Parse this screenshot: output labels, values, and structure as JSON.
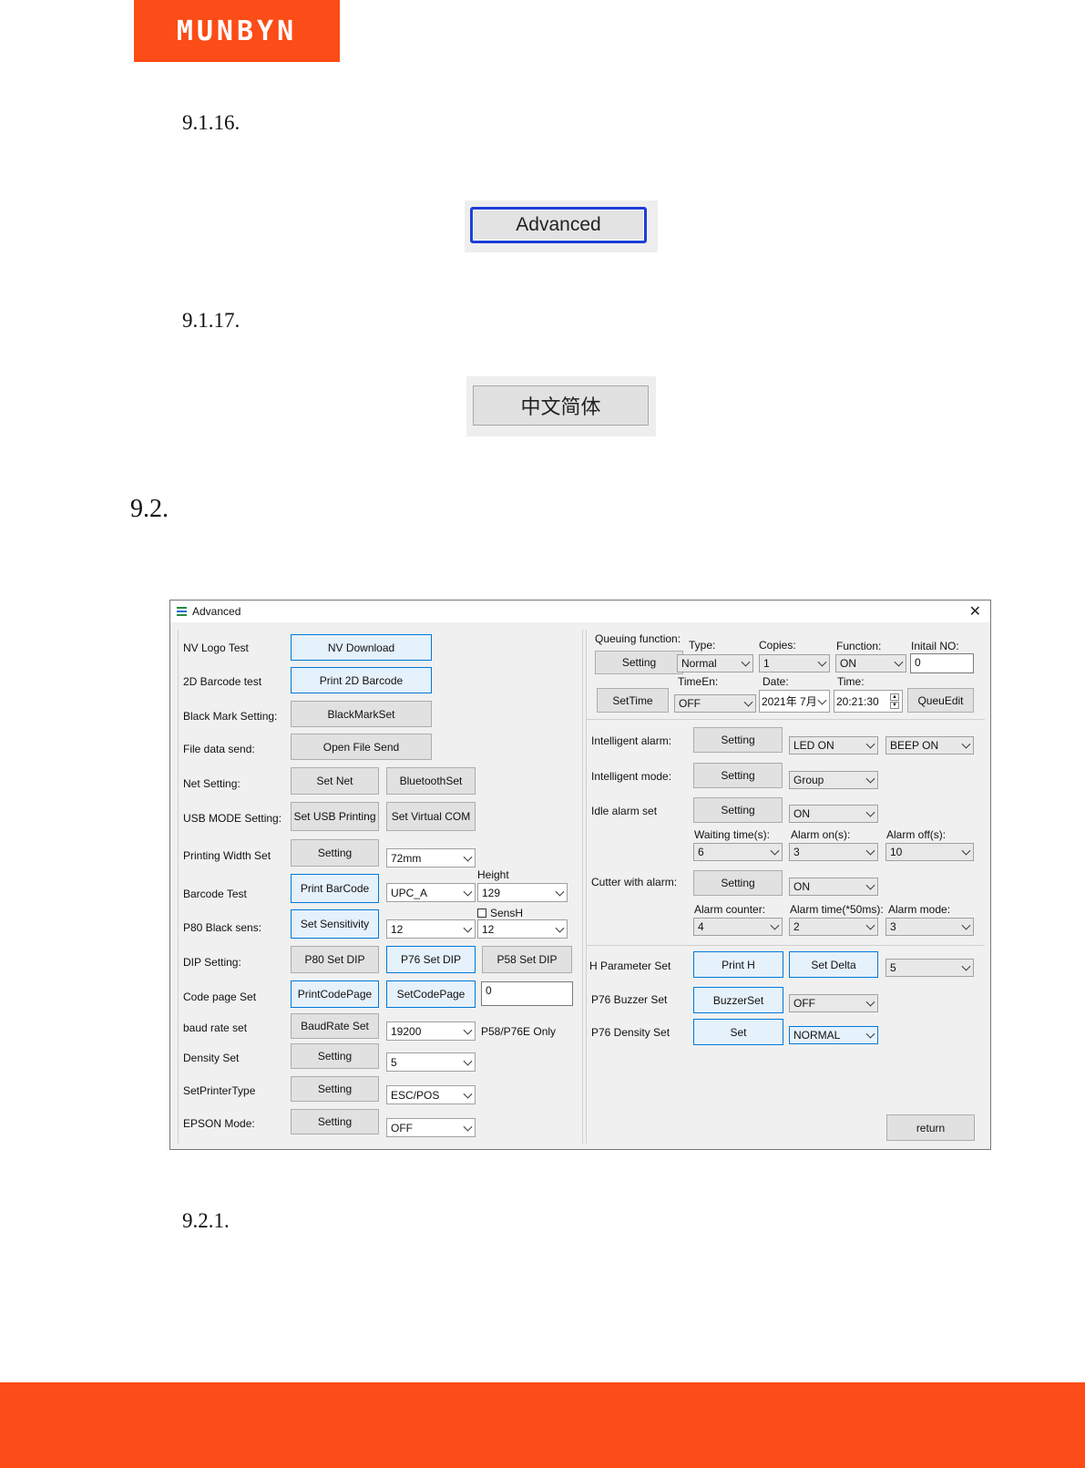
{
  "brand": {
    "logo_text": "MUNBYN"
  },
  "sections": {
    "s9116": "9.1.16.",
    "s9117": "9.1.17.",
    "s92": "9.2.",
    "s921": "9.2.1."
  },
  "snippets": {
    "advanced_button": "Advanced",
    "chinese_button": "中文简体"
  },
  "window": {
    "title": "Advanced",
    "close_glyph": "✕",
    "left": {
      "nv_logo_label": "NV Logo Test",
      "nv_download": "NV Download",
      "barcode2d_label": "2D Barcode test",
      "print_2d_barcode": "Print 2D Barcode",
      "black_mark_label": "Black Mark Setting:",
      "black_mark_set": "BlackMarkSet",
      "file_data_label": "File data send:",
      "open_file_send": "Open File Send",
      "net_label": "Net Setting:",
      "set_net": "Set Net",
      "bluetooth_set": "BluetoothSet",
      "usb_mode_label": "USB MODE Setting:",
      "set_usb_printing": "Set USB Printing",
      "set_virtual_com": "Set Virtual COM",
      "print_width_label": "Printing Width Set",
      "print_width_setting": "Setting",
      "print_width_value": "72mm",
      "barcode_test_label": "Barcode Test",
      "print_barcode": "Print BarCode",
      "barcode_type_value": "UPC_A",
      "height_label": "Height",
      "height_value": "129",
      "sensh_label": "SensH",
      "p80_black_label": "P80 Black sens:",
      "set_sensitivity": "Set Sensitivity",
      "sensitivity_value": "12",
      "sensh_value": "12",
      "dip_label": "DIP Setting:",
      "p80_set_dip": "P80 Set DIP",
      "p76_set_dip": "P76 Set DIP",
      "p58_set_dip": "P58 Set DIP",
      "code_page_label": "Code page Set",
      "print_code_page": "PrintCodePage",
      "set_code_page": "SetCodePage",
      "code_page_value": "0",
      "baud_label": "baud rate set",
      "baud_rate_set": "BaudRate Set",
      "baud_value": "19200",
      "baud_note": "P58/P76E Only",
      "density_label": "Density Set",
      "density_setting": "Setting",
      "density_value": "5",
      "printer_type_label": "SetPrinterType",
      "printer_type_setting": "Setting",
      "printer_type_value": "ESC/POS",
      "epson_label": "EPSON Mode:",
      "epson_setting": "Setting",
      "epson_value": "OFF"
    },
    "right": {
      "queuing_label": "Queuing function:",
      "type_label": "Type:",
      "copies_label": "Copies:",
      "function_label": "Function:",
      "initial_no_label": "Initail NO:",
      "queuing_setting": "Setting",
      "type_value": "Normal",
      "copies_value": "1",
      "function_value": "ON",
      "initial_no_value": "0",
      "time_en_label": "TimeEn:",
      "date_label": "Date:",
      "time_label": "Time:",
      "set_time": "SetTime",
      "time_en_value": "OFF",
      "date_value": "2021年  7月",
      "time_value": "20:21:30",
      "queu_edit": "QueuEdit",
      "intelligent_alarm_label": "Intelligent alarm:",
      "intelligent_alarm_setting": "Setting",
      "led_value": "LED ON",
      "beep_value": "BEEP ON",
      "intelligent_mode_label": "Intelligent mode:",
      "intelligent_mode_setting": "Setting",
      "mode_value": "Group",
      "idle_alarm_label": "Idle alarm set",
      "idle_alarm_setting": "Setting",
      "idle_value": "ON",
      "waiting_time_label": "Waiting time(s):",
      "alarm_on_label": "Alarm on(s):",
      "alarm_off_label": "Alarm off(s):",
      "waiting_time_value": "6",
      "alarm_on_value": "3",
      "alarm_off_value": "10",
      "cutter_label": "Cutter with alarm:",
      "cutter_setting": "Setting",
      "cutter_value": "ON",
      "alarm_counter_label": "Alarm counter:",
      "alarm_time_label": "Alarm time(*50ms):",
      "alarm_mode_label": "Alarm mode:",
      "alarm_counter_value": "4",
      "alarm_time_value": "2",
      "alarm_mode_value": "3",
      "h_param_label": "H Parameter Set",
      "print_h": "Print H",
      "set_delta": "Set Delta",
      "h_value": "5",
      "buzzer_label": "P76 Buzzer Set",
      "buzzer_set": "BuzzerSet",
      "buzzer_value": "OFF",
      "density_label": "P76 Density Set",
      "density_set": "Set",
      "density_value": "NORMAL",
      "return": "return"
    }
  }
}
